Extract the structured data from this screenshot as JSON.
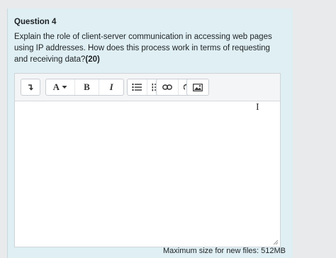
{
  "question": {
    "title": "Question 4",
    "text_main": "Explain the role of client-server communication in accessing web pages using IP addresses. How does this process work in terms of requesting and receiving data?",
    "marks": "(20)"
  },
  "toolbar": {
    "font_label": "A",
    "bold_label": "B",
    "italic_label": "I"
  },
  "editor": {
    "content": ""
  },
  "footer": {
    "max_size_text": "Maximum size for new files: 512MB"
  },
  "colors": {
    "card_bg": "#dfeff3",
    "page_bg": "#e9eaeb"
  },
  "icons": [
    "expand-toolbar-icon",
    "dropdown-caret-icon",
    "unordered-list-icon",
    "ordered-list-icon",
    "link-icon",
    "unlink-icon",
    "image-icon",
    "text-cursor-icon",
    "resize-handle-icon"
  ]
}
